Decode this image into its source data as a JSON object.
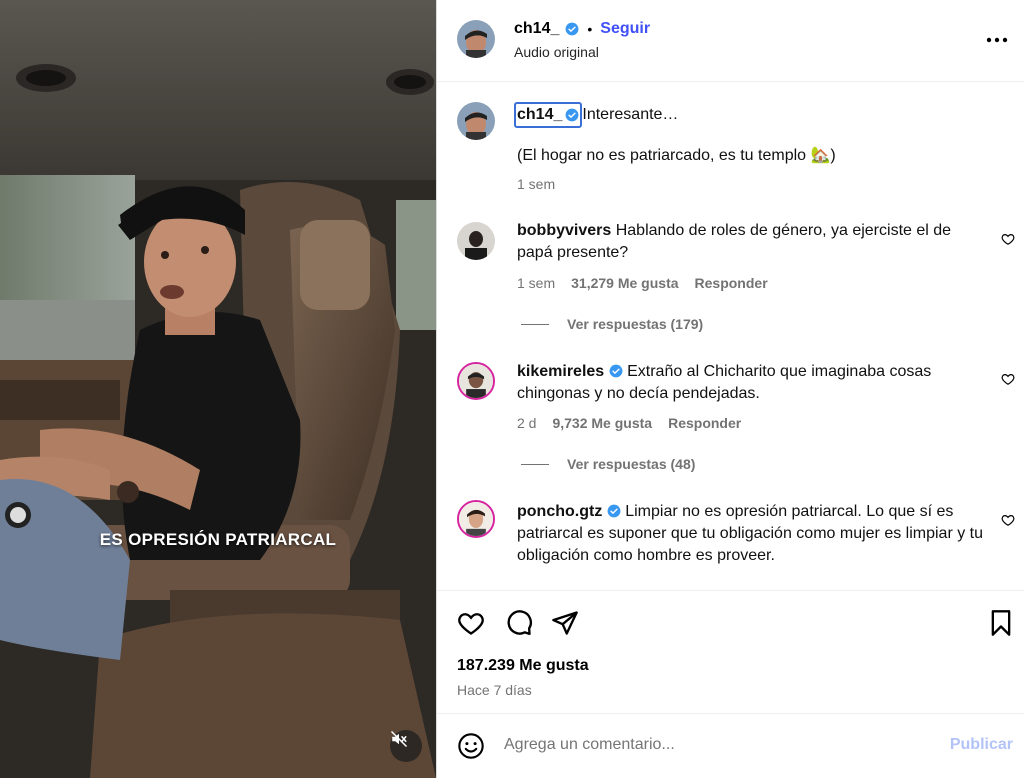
{
  "video": {
    "overlay_caption": "ES OPRESIÓN PATRIARCAL",
    "mute_icon": "speaker-muted-icon"
  },
  "header": {
    "username": "ch14_",
    "separator": "•",
    "follow_label": "Seguir",
    "audio_label": "Audio original",
    "more_icon": "more-horizontal-icon"
  },
  "caption": {
    "username": "ch14_",
    "text_line1": "Interesante…",
    "text_line2": "(El hogar no es patriarcado, es tu templo 🏡)",
    "time": "1 sem"
  },
  "comments": [
    {
      "username": "bobbyvivers",
      "text": "Hablando de roles de género, ya ejerciste el de papá presente?",
      "time": "1 sem",
      "likes": "31,279 Me gusta",
      "reply_label": "Responder",
      "view_replies": "Ver respuestas (179)",
      "verified": false
    },
    {
      "username": "kikemireles",
      "text": "Extraño al Chicharito que imaginaba cosas chingonas y no decía pendejadas.",
      "time": "2 d",
      "likes": "9,732 Me gusta",
      "reply_label": "Responder",
      "view_replies": "Ver respuestas (48)",
      "verified": true
    },
    {
      "username": "poncho.gtz",
      "text": "Limpiar no es opresión patriarcal. Lo que sí es patriarcal es suponer que tu obligación como mujer es limpiar y tu obligación como hombre es proveer.",
      "verified": true
    }
  ],
  "actions": {
    "like_icon": "heart-icon",
    "comment_icon": "comment-icon",
    "share_icon": "send-icon",
    "save_icon": "bookmark-icon",
    "likes_count": "187.239 Me gusta",
    "time_ago": "Hace 7 días"
  },
  "comment_box": {
    "placeholder": "Agrega un comentario...",
    "publish_label": "Publicar",
    "emoji_icon": "emoji-icon"
  },
  "colors": {
    "accent": "#4150f7",
    "verified": "#3897f0",
    "muted": "#737373",
    "publish_disabled": "#b3c3f8"
  }
}
